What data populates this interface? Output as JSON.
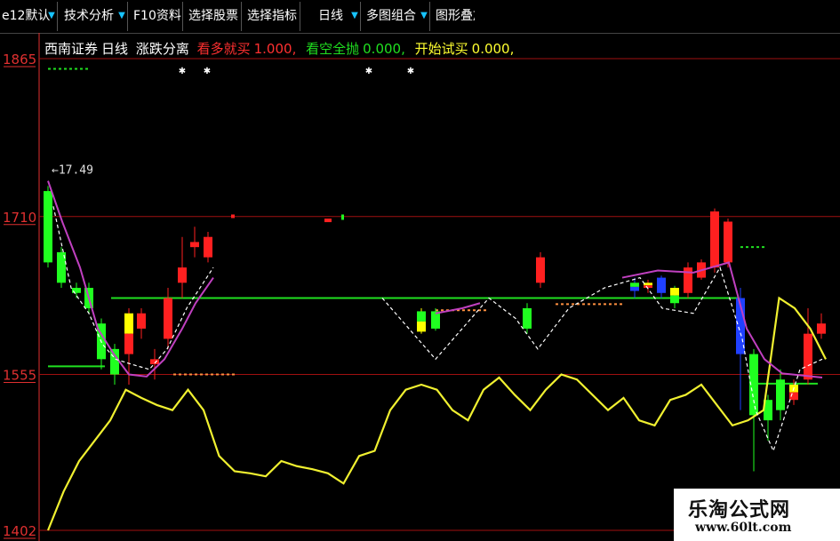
{
  "toolbar": {
    "items": [
      "e12默认",
      "技术分析",
      "F10资料",
      "选择股票",
      "选择指标",
      "日线",
      "多图组合",
      "图形叠加"
    ]
  },
  "info": {
    "stock": "西南证券",
    "period": "日线",
    "indicator": "涨跌分离",
    "buy_label": "看多就买",
    "buy_value": "1.000,",
    "sell_label": "看空全抛",
    "sell_value": "0.000,",
    "start_label": "开始试买",
    "start_value": "0.000,"
  },
  "annotation": "17.49",
  "watermark": {
    "title": "乐淘公式网",
    "url": "www.60lt.com"
  },
  "colors": {
    "up": "#ff2020",
    "down": "#20ff20",
    "signal_yellow": "#ffff00",
    "signal_blue": "#2040ff",
    "ma_purple": "#c040c0",
    "yellow_line": "#f0f030",
    "green_level": "#20e020",
    "grid_red": "#a01010",
    "axis_red": "#e03030"
  },
  "chart_data": {
    "type": "candlestick",
    "y_ticks": [
      1865,
      1710,
      1555,
      1402
    ],
    "ylim": [
      1402,
      1865
    ],
    "grid": "horizontal",
    "level_line": 1630,
    "candles": [
      {
        "o": 1665,
        "c": 1735,
        "l": 1660,
        "h": 1740,
        "color": "green"
      },
      {
        "o": 1645,
        "c": 1675,
        "l": 1640,
        "h": 1680,
        "color": "green"
      },
      {
        "o": 1635,
        "c": 1640,
        "l": 1630,
        "h": 1645,
        "color": "green"
      },
      {
        "o": 1620,
        "c": 1640,
        "l": 1615,
        "h": 1645,
        "color": "green"
      },
      {
        "o": 1570,
        "c": 1605,
        "l": 1560,
        "h": 1610,
        "color": "green"
      },
      {
        "o": 1555,
        "c": 1580,
        "l": 1545,
        "h": 1585,
        "color": "green"
      },
      {
        "o": 1575,
        "c": 1615,
        "l": 1545,
        "h": 1620,
        "color": "yellow-red"
      },
      {
        "o": 1600,
        "c": 1615,
        "l": 1590,
        "h": 1620,
        "color": "red"
      },
      {
        "o": 1565,
        "c": 1570,
        "l": 1550,
        "h": 1580,
        "color": "red"
      },
      {
        "o": 1590,
        "c": 1630,
        "l": 1580,
        "h": 1640,
        "color": "red"
      },
      {
        "o": 1645,
        "c": 1660,
        "l": 1630,
        "h": 1690,
        "color": "red"
      },
      {
        "o": 1680,
        "c": 1685,
        "l": 1670,
        "h": 1700,
        "color": "red"
      },
      {
        "o": 1670,
        "c": 1690,
        "l": 1665,
        "h": 1695,
        "color": "red"
      },
      {
        "o": 1597,
        "c": 1617,
        "l": 1595,
        "h": 1620,
        "color": "green-yellow"
      },
      {
        "o": 1600,
        "c": 1617,
        "l": 1598,
        "h": 1620,
        "color": "green"
      },
      {
        "o": 1600,
        "c": 1620,
        "l": 1595,
        "h": 1625,
        "color": "green"
      },
      {
        "o": 1645,
        "c": 1670,
        "l": 1640,
        "h": 1675,
        "color": "red"
      },
      {
        "o": 1637,
        "c": 1645,
        "l": 1630,
        "h": 1650,
        "color": "green-blue"
      },
      {
        "o": 1640,
        "c": 1645,
        "l": 1635,
        "h": 1648,
        "color": "yellow-red"
      },
      {
        "o": 1635,
        "c": 1650,
        "l": 1630,
        "h": 1652,
        "color": "blue"
      },
      {
        "o": 1625,
        "c": 1640,
        "l": 1620,
        "h": 1642,
        "color": "yellow-green"
      },
      {
        "o": 1635,
        "c": 1660,
        "l": 1630,
        "h": 1665,
        "color": "red"
      },
      {
        "o": 1650,
        "c": 1665,
        "l": 1648,
        "h": 1668,
        "color": "red"
      },
      {
        "o": 1660,
        "c": 1715,
        "l": 1655,
        "h": 1718,
        "color": "red"
      },
      {
        "o": 1665,
        "c": 1705,
        "l": 1660,
        "h": 1708,
        "color": "red"
      },
      {
        "o": 1575,
        "c": 1630,
        "l": 1520,
        "h": 1640,
        "color": "blue"
      },
      {
        "o": 1515,
        "c": 1575,
        "l": 1460,
        "h": 1580,
        "color": "green"
      },
      {
        "o": 1510,
        "c": 1530,
        "l": 1490,
        "h": 1535,
        "color": "green"
      },
      {
        "o": 1520,
        "c": 1550,
        "l": 1510,
        "h": 1560,
        "color": "green"
      },
      {
        "o": 1530,
        "c": 1545,
        "l": 1525,
        "h": 1550,
        "color": "yellow-red"
      },
      {
        "o": 1550,
        "c": 1595,
        "l": 1545,
        "h": 1620,
        "color": "red"
      },
      {
        "o": 1595,
        "c": 1605,
        "l": 1590,
        "h": 1615,
        "color": "red"
      }
    ],
    "yellow_line": [
      1402,
      1440,
      1470,
      1490,
      1510,
      1540,
      1532,
      1525,
      1520,
      1540,
      1520,
      1475,
      1460,
      1458,
      1455,
      1470,
      1465,
      1462,
      1458,
      1448,
      1475,
      1480,
      1520,
      1540,
      1545,
      1540,
      1520,
      1510,
      1540,
      1552,
      1535,
      1520,
      1540,
      1555,
      1550,
      1535,
      1520,
      1532,
      1510,
      1505,
      1530,
      1535,
      1545,
      1525,
      1505,
      1510,
      1520,
      1630,
      1620,
      1600,
      1570
    ]
  }
}
